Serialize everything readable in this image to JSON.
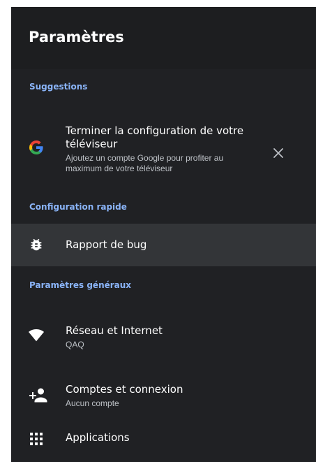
{
  "header": {
    "title": "Paramètres"
  },
  "sections": {
    "suggestions": "Suggestions",
    "quick_setup": "Configuration rapide",
    "general": "Paramètres généraux"
  },
  "suggestion_card": {
    "icon": "google-icon",
    "title": "Terminer la configuration de votre téléviseur",
    "subtitle": "Ajoutez un compte Google pour profiter au maximum de votre téléviseur",
    "dismiss_icon": "close-icon"
  },
  "quick_items": [
    {
      "icon": "bug-icon",
      "title": "Rapport de bug"
    }
  ],
  "general_items": [
    {
      "icon": "wifi-icon",
      "title": "Réseau et Internet",
      "subtitle": "QAQ"
    },
    {
      "icon": "add-account-icon",
      "title": "Comptes et connexion",
      "subtitle": "Aucun compte"
    },
    {
      "icon": "apps-grid-icon",
      "title": "Applications"
    }
  ],
  "colors": {
    "panel_bg": "#202124",
    "header_bg": "#1d1e20",
    "focused_row_bg": "#333538",
    "section_label": "#8ab4f8",
    "text_primary": "#ffffff",
    "text_secondary": "#bdc1c6"
  }
}
